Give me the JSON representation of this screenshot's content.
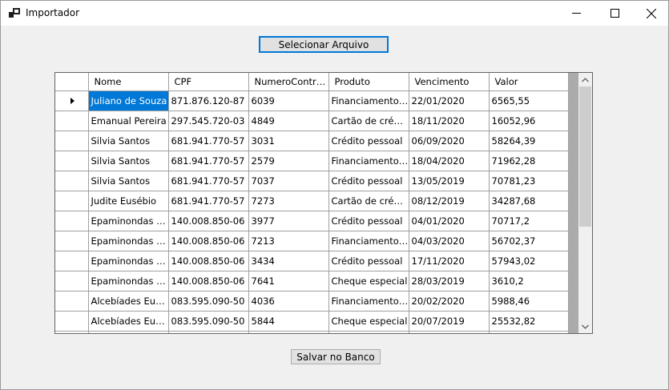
{
  "window": {
    "title": "Importador",
    "icon": "app-window-icon"
  },
  "buttons": {
    "select_file": "Selecionar Arquivo",
    "save_db": "Salvar no Banco"
  },
  "grid": {
    "columns": [
      "Nome",
      "CPF",
      "NumeroContrato",
      "Produto",
      "Vencimento",
      "Valor"
    ],
    "rows": [
      [
        "Juliano de Souza",
        "871.876.120-87",
        "6039",
        "Financiamento ...",
        "22/01/2020",
        "6565,55"
      ],
      [
        "Emanual Pereira",
        "297.545.720-03",
        "4849",
        "Cartão de crédito",
        "18/11/2020",
        "16052,96"
      ],
      [
        "Silvia Santos",
        "681.941.770-57",
        "3031",
        "Crédito pessoal",
        "06/09/2020",
        "58264,39"
      ],
      [
        "Silvia Santos",
        "681.941.770-57",
        "2579",
        "Financiamento ...",
        "18/04/2020",
        "71962,28"
      ],
      [
        "Silvia Santos",
        "681.941.770-57",
        "7037",
        "Crédito pessoal",
        "13/05/2019",
        "70781,23"
      ],
      [
        "Judite Eusébio",
        "681.941.770-57",
        "7273",
        "Cartão de crédito",
        "08/12/2019",
        "34287,68"
      ],
      [
        "Epaminondas C...",
        "140.008.850-06",
        "3977",
        "Crédito pessoal",
        "04/01/2020",
        "70717,2"
      ],
      [
        "Epaminondas C...",
        "140.008.850-06",
        "7213",
        "Financiamento ...",
        "04/03/2020",
        "56702,37"
      ],
      [
        "Epaminondas C...",
        "140.008.850-06",
        "3434",
        "Crédito pessoal",
        "17/11/2020",
        "57943,02"
      ],
      [
        "Epaminondas C...",
        "140.008.850-06",
        "7641",
        "Cheque especial",
        "28/03/2019",
        "3610,2"
      ],
      [
        "Alcebíades Eust...",
        "083.595.090-50",
        "4036",
        "Financiamento ...",
        "20/02/2020",
        "5988,46"
      ],
      [
        "Alcebíades Eust...",
        "083.595.090-50",
        "5844",
        "Cheque especial",
        "20/07/2019",
        "25532,82"
      ],
      [
        "",
        "",
        "",
        "",
        "",
        ""
      ]
    ],
    "selected_row": 0
  },
  "colors": {
    "selection": "#0078d7",
    "window_bg": "#f0f0f0"
  }
}
